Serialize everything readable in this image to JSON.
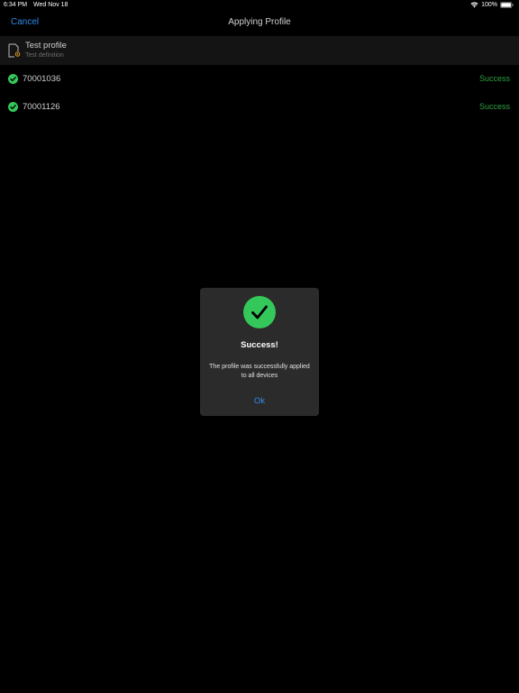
{
  "status_bar": {
    "time": "6:34 PM",
    "date": "Wed Nov 18",
    "battery": "100%"
  },
  "nav": {
    "cancel_label": "Cancel",
    "title": "Applying Profile"
  },
  "profile": {
    "name": "Test profile",
    "description": "Test definition",
    "icon": "profile-document-gear-icon"
  },
  "devices": [
    {
      "id": "70001036",
      "status": "Success"
    },
    {
      "id": "70001126",
      "status": "Success"
    }
  ],
  "dialog": {
    "title": "Success!",
    "message": "The profile was successfully applied to all devices",
    "ok_label": "Ok"
  },
  "colors": {
    "accent": "#2f8bea",
    "success": "#2ea043",
    "success_icon": "#34c759",
    "background": "#000000",
    "dialog_bg": "#2b2b2b"
  }
}
